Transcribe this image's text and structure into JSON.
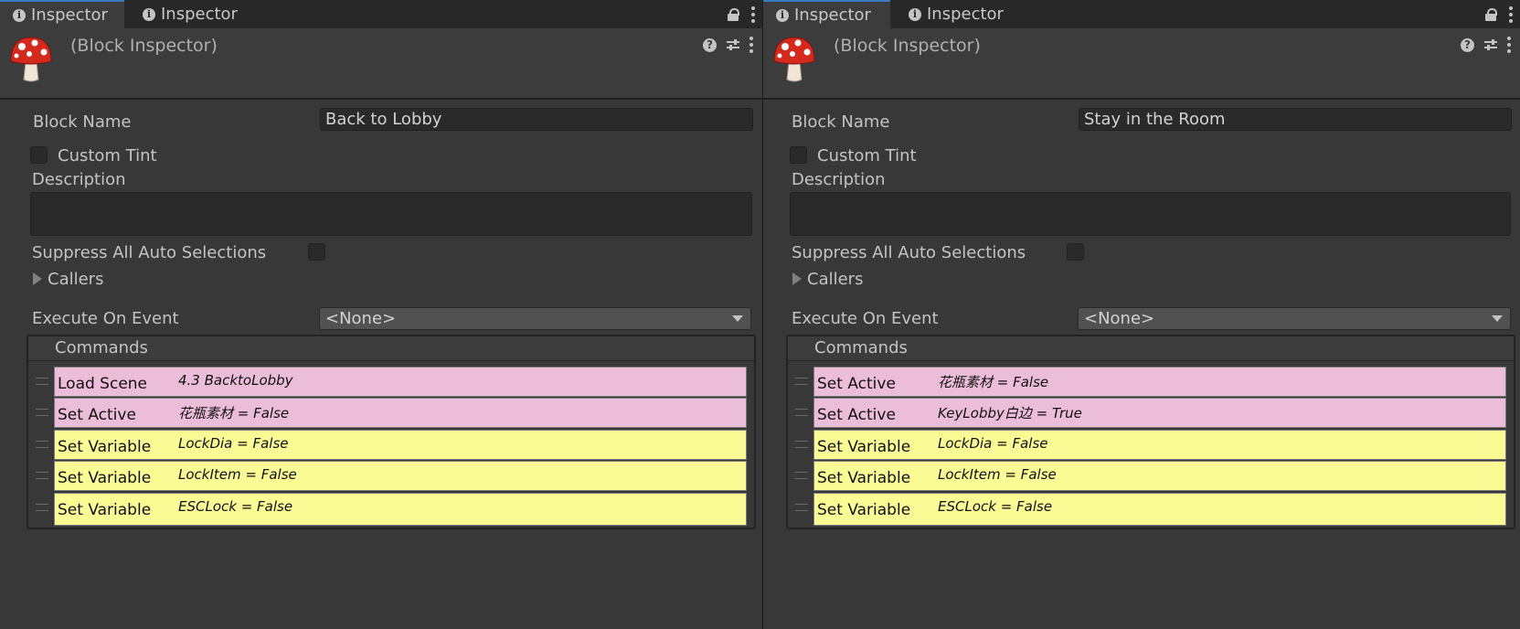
{
  "colors": {
    "background": "#383838",
    "tab_accent": "#3a79bb",
    "command_pink": "#ebbdd8",
    "command_yellow": "#fbfb95"
  },
  "panels": [
    {
      "tabs": [
        {
          "label": "Inspector",
          "icon": "info-icon",
          "active": true
        },
        {
          "label": "Inspector",
          "icon": "info-icon",
          "active": false
        }
      ],
      "header_title": "(Block Inspector)",
      "block_name_label": "Block Name",
      "block_name_value": "Back to Lobby",
      "custom_tint_label": "Custom Tint",
      "description_label": "Description",
      "suppress_label": "Suppress All Auto Selections",
      "callers_label": "Callers",
      "execute_label": "Execute On Event",
      "execute_value": "<None>",
      "commands_label": "Commands",
      "commands": [
        {
          "name": "Load Scene",
          "summary": "4.3 BacktoLobby",
          "color": "pink"
        },
        {
          "name": "Set Active",
          "summary": "花瓶素材 = False",
          "color": "pink"
        },
        {
          "name": "Set Variable",
          "summary": "LockDia = False",
          "color": "yellow"
        },
        {
          "name": "Set Variable",
          "summary": "LockItem = False",
          "color": "yellow"
        },
        {
          "name": "Set Variable",
          "summary": "ESCLock = False",
          "color": "yellow"
        }
      ]
    },
    {
      "tabs": [
        {
          "label": "Inspector",
          "icon": "info-icon",
          "active": true
        },
        {
          "label": "Inspector",
          "icon": "info-icon",
          "active": false
        }
      ],
      "header_title": "(Block Inspector)",
      "block_name_label": "Block Name",
      "block_name_value": "Stay in the Room",
      "custom_tint_label": "Custom Tint",
      "description_label": "Description",
      "suppress_label": "Suppress All Auto Selections",
      "callers_label": "Callers",
      "execute_label": "Execute On Event",
      "execute_value": "<None>",
      "commands_label": "Commands",
      "commands": [
        {
          "name": "Set Active",
          "summary": "花瓶素材 = False",
          "color": "pink"
        },
        {
          "name": "Set Active",
          "summary": "KeyLobby白边 = True",
          "color": "pink"
        },
        {
          "name": "Set Variable",
          "summary": "LockDia = False",
          "color": "yellow"
        },
        {
          "name": "Set Variable",
          "summary": "LockItem = False",
          "color": "yellow"
        },
        {
          "name": "Set Variable",
          "summary": "ESCLock = False",
          "color": "yellow"
        }
      ]
    }
  ]
}
